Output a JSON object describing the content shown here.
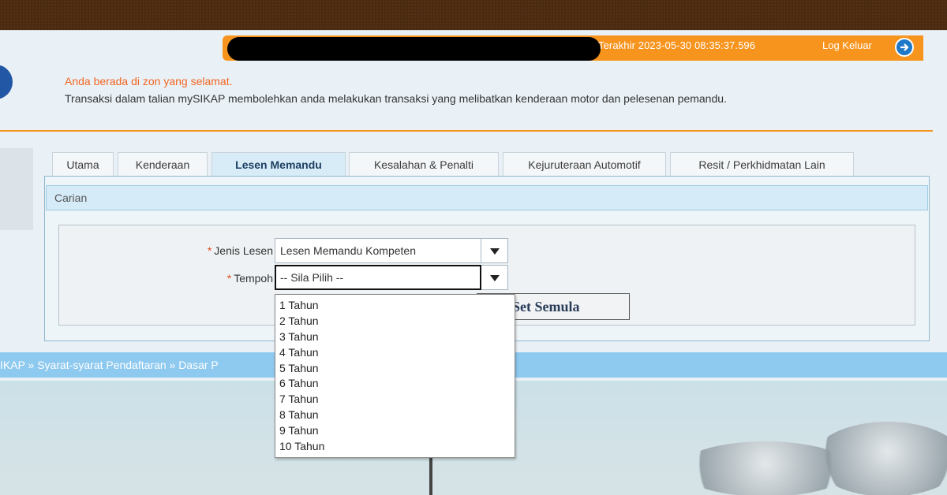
{
  "header": {
    "last_login": "Terakhir 2023-05-30 08:35:37.596",
    "logout_label": "Log Keluar"
  },
  "notice": {
    "safe_zone": "Anda berada di zon yang selamat.",
    "intro": "Transaksi dalam talian mySIKAP membolehkan anda melakukan transaksi yang melibatkan kenderaan motor dan pelesenan pemandu."
  },
  "tabs": [
    {
      "label": "Utama"
    },
    {
      "label": "Kenderaan"
    },
    {
      "label": "Lesen Memandu"
    },
    {
      "label": "Kesalahan & Penalti"
    },
    {
      "label": "Kejuruteraan Automotif"
    },
    {
      "label": "Resit / Perkhidmatan Lain"
    }
  ],
  "active_tab": "Lesen Memandu",
  "section_title": "Carian",
  "form": {
    "required_mark": "*",
    "licence_type_label": "Jenis Lesen",
    "licence_type_value": "Lesen Memandu Kompeten",
    "period_label": "Tempoh",
    "period_value": "-- Sila Pilih --",
    "reset_label": "Set Semula"
  },
  "period_options": [
    "1 Tahun",
    "2 Tahun",
    "3 Tahun",
    "4 Tahun",
    "5 Tahun",
    "6 Tahun",
    "7 Tahun",
    "8 Tahun",
    "9 Tahun",
    "10 Tahun"
  ],
  "breadcrumb": "IKAP » Syarat-syarat Pendaftaran » Dasar P",
  "colors": {
    "accent_orange": "#f7941d",
    "top_bar": "#4a2a10",
    "safe_zone_text": "#f26522",
    "breadcrumb_bar": "#8ec9ef"
  }
}
